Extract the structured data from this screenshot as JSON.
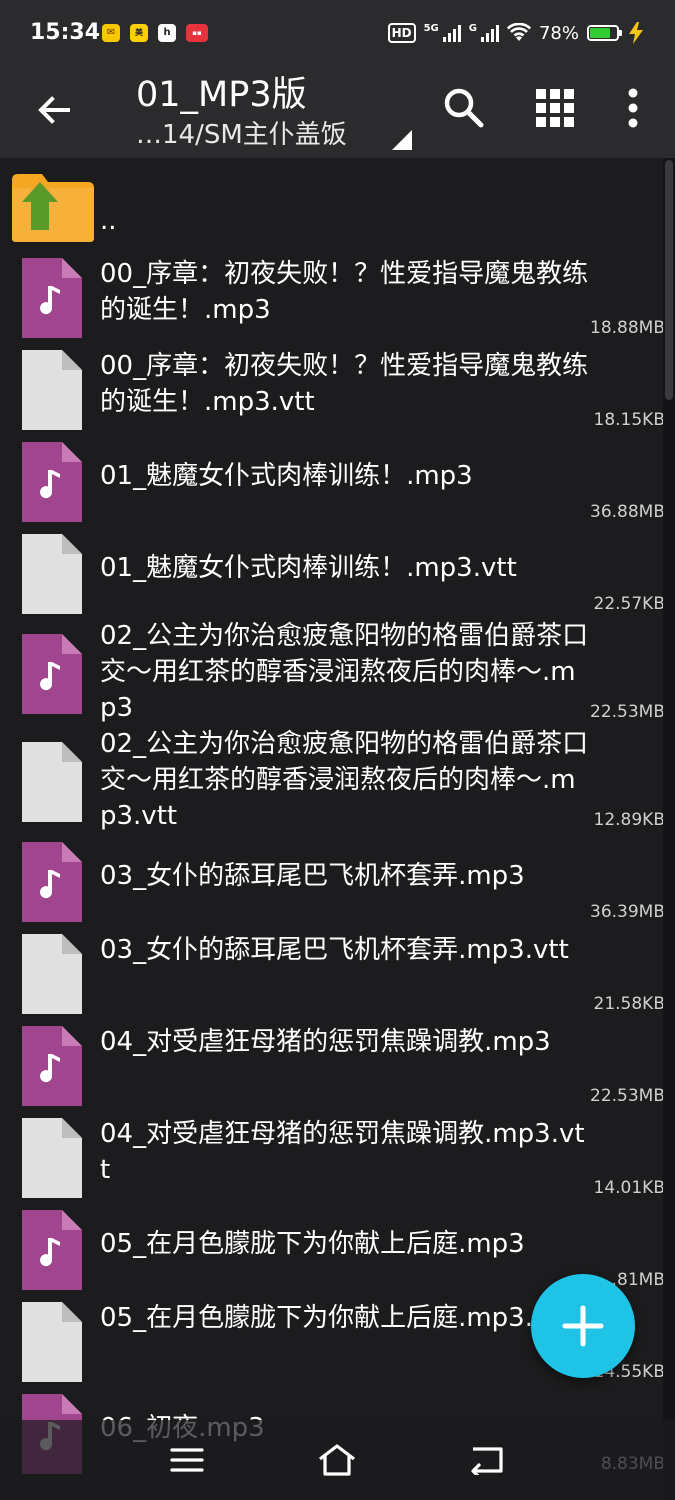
{
  "status_bar": {
    "time": "15:34",
    "battery_percent": "78%",
    "battery_level": 0.78,
    "hd_label": "HD",
    "net1_label": "5G",
    "net2_label": "G"
  },
  "toolbar": {
    "title": "01_MP3版",
    "subtitle": "…14/SM主仆盖饭"
  },
  "parent_dir": {
    "label": ".."
  },
  "files": [
    {
      "name": "00_序章：初夜失败！？性爱指导魔鬼教练的诞生！.mp3",
      "size": "18.88MB",
      "type": "audio"
    },
    {
      "name": "00_序章：初夜失败！？性爱指导魔鬼教练的诞生！.mp3.vtt",
      "size": "18.15KB",
      "type": "doc"
    },
    {
      "name": "01_魅魔女仆式肉棒训练！.mp3",
      "size": "36.88MB",
      "type": "audio"
    },
    {
      "name": "01_魅魔女仆式肉棒训练！.mp3.vtt",
      "size": "22.57KB",
      "type": "doc"
    },
    {
      "name": "02_公主为你治愈疲惫阳物的格雷伯爵茶口交～用红茶的醇香浸润熬夜后的肉棒～.mp3",
      "size": "22.53MB",
      "type": "audio"
    },
    {
      "name": "02_公主为你治愈疲惫阳物的格雷伯爵茶口交～用红茶的醇香浸润熬夜后的肉棒～.mp3.vtt",
      "size": "12.89KB",
      "type": "doc"
    },
    {
      "name": "03_女仆的舔耳尾巴飞机杯套弄.mp3",
      "size": "36.39MB",
      "type": "audio"
    },
    {
      "name": "03_女仆的舔耳尾巴飞机杯套弄.mp3.vtt",
      "size": "21.58KB",
      "type": "doc"
    },
    {
      "name": "04_对受虐狂母猪的惩罚焦躁调教.mp3",
      "size": "22.53MB",
      "type": "audio"
    },
    {
      "name": "04_对受虐狂母猪的惩罚焦躁调教.mp3.vtt",
      "size": "14.01KB",
      "type": "doc"
    },
    {
      "name": "05_在月色朦胧下为你献上后庭.mp3",
      "size": "…81MB",
      "type": "audio"
    },
    {
      "name": "05_在月色朦胧下为你献上后庭.mp3.vtt",
      "size": "14.55KB",
      "type": "doc"
    },
    {
      "name": "06_初夜.mp3",
      "size": "8.83MB",
      "type": "audio"
    }
  ],
  "colors": {
    "background": "#1c1c1e",
    "toolbar": "#2b2b2d",
    "audio_icon": "#a0468f",
    "doc_icon": "#e0e0e0",
    "fab": "#1ec3e6",
    "folder": "#f5a623",
    "up_arrow": "#5a9a2a"
  },
  "icons": {
    "back": "arrow-left-icon",
    "search": "search-icon",
    "grid": "grid-view-icon",
    "more": "more-vert-icon",
    "fab": "plus-icon",
    "nav_menu": "menu-icon",
    "nav_home": "home-icon",
    "nav_back": "back-icon"
  }
}
